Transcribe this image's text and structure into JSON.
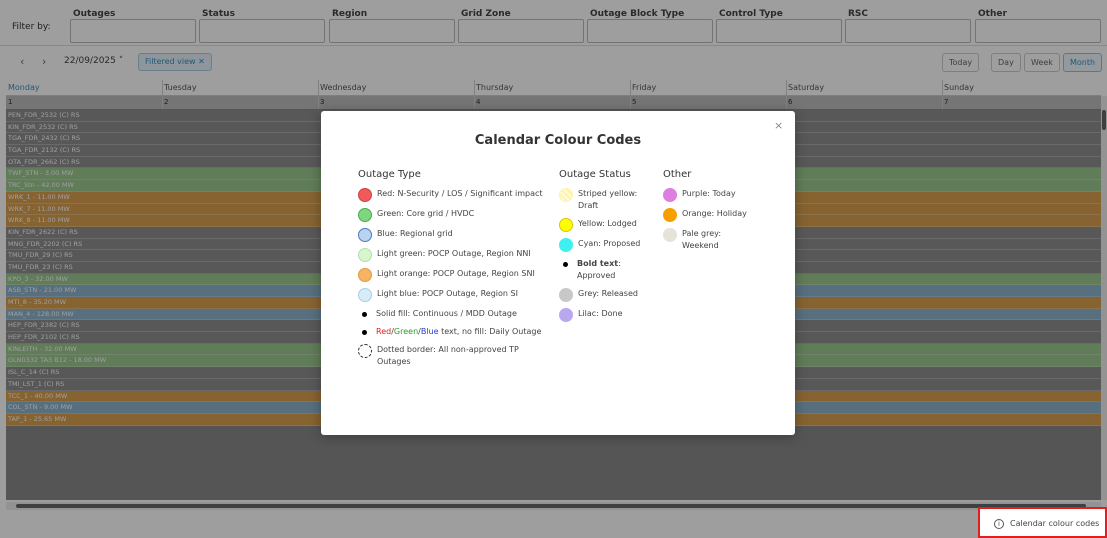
{
  "filters": {
    "label": "Filter by:",
    "columns": [
      {
        "title": "Outages"
      },
      {
        "title": "Status"
      },
      {
        "title": "Region"
      },
      {
        "title": "Grid Zone"
      },
      {
        "title": "Outage Block Type"
      },
      {
        "title": "Control Type"
      },
      {
        "title": "RSC"
      },
      {
        "title": "Other"
      }
    ]
  },
  "toolbar": {
    "prev": "‹",
    "next": "›",
    "date": "22/09/2025 ˅",
    "filtered_chip": "Filtered view ✕",
    "views": {
      "today": "Today",
      "day": "Day",
      "week": "Week",
      "month": "Month"
    },
    "active_view": "Month"
  },
  "calendar": {
    "days": [
      "Monday",
      "Tuesday",
      "Wednesday",
      "Thursday",
      "Friday",
      "Saturday",
      "Sunday"
    ],
    "day_numbers": [
      "1",
      "2",
      "3",
      "4",
      "5",
      "6",
      "7"
    ],
    "rows": [
      {
        "label": "PEN_FDR_2532 (C) RS",
        "color": "grey"
      },
      {
        "label": "KIN_FDR_2532 (C) RS",
        "color": "grey"
      },
      {
        "label": "TGA_FDR_2432 (C) RS",
        "color": "grey"
      },
      {
        "label": "TGA_FDR_2132 (C) RS",
        "color": "grey"
      },
      {
        "label": "OTA_FDR_2662 (C) RS",
        "color": "grey"
      },
      {
        "label": "TWF_STN - 3.00 MW",
        "color": "green"
      },
      {
        "label": "TRC_Stn - 42.00 MW",
        "color": "green"
      },
      {
        "label": "WRK_1 - 11.00 MW",
        "color": "orange"
      },
      {
        "label": "WRK_7 - 11.00 MW",
        "color": "orange"
      },
      {
        "label": "WRK_8 - 11.00 MW",
        "color": "orange"
      },
      {
        "label": "KIN_FDR_2622 (C) RS",
        "color": "grey"
      },
      {
        "label": "MNG_FDR_2202 (C) RS",
        "color": "grey"
      },
      {
        "label": "TMU_FDR_29 (C) RS",
        "color": "grey"
      },
      {
        "label": "TMU_FDR_23 (C) RS",
        "color": "grey"
      },
      {
        "label": "KPO_3 - 32.00 MW",
        "color": "green"
      },
      {
        "label": "ASB_STN - 21.00 MW",
        "color": "blue"
      },
      {
        "label": "MTI_8 - 35.20 MW",
        "color": "orange"
      },
      {
        "label": "MAN_4 - 128.00 MW",
        "color": "blue"
      },
      {
        "label": "HEP_FDR_2382 (C) RS",
        "color": "grey"
      },
      {
        "label": "HEP_FDR_2102 (C) RS",
        "color": "grey"
      },
      {
        "label": "KINLEITH - 32.00 MW",
        "color": "green"
      },
      {
        "label": "GLN0332 TA3 B12 - 18.00 MW",
        "color": "green"
      },
      {
        "label": "ISL_C_14 (C) RS",
        "color": "grey"
      },
      {
        "label": "TMI_LST_1 (C) RS",
        "color": "grey"
      },
      {
        "label": "TCC_1 - 40.00 MW",
        "color": "orange"
      },
      {
        "label": "COL_STN - 9.00 MW",
        "color": "blue"
      },
      {
        "label": "TAP_1 - 25.65 MW",
        "color": "orange"
      }
    ]
  },
  "modal": {
    "title": "Calendar Colour Codes",
    "close": "×",
    "outage_type": {
      "title": "Outage Type",
      "items": [
        {
          "text": "Red: N-Security / LOS / Significant impact",
          "fill": "#f05a5a",
          "border": "#d04040"
        },
        {
          "text": "Green: Core grid / HVDC",
          "fill": "#7ed67e",
          "border": "#4caa4c"
        },
        {
          "text": "Blue: Regional grid",
          "fill": "#b9d4f0",
          "border": "#4a78c0"
        },
        {
          "text": "Light green: POCP Outage, Region NNI",
          "fill": "#d8f5d0",
          "border": "#b0e0a8"
        },
        {
          "text": "Light orange: POCP Outage, Region SNI",
          "fill": "#f5b562",
          "border": "#e09a40"
        },
        {
          "text": "Light blue: POCP Outage, Region SI",
          "fill": "#d6ecf8",
          "border": "#a8cde6"
        }
      ],
      "solid_fill": "Solid fill: Continuous / MDD Outage",
      "text_red": "Red",
      "text_green": "Green",
      "text_blue": "Blue",
      "text_rest": "text, no fill: Daily Outage",
      "slash": "/",
      "dotted": "Dotted border: All non-approved TP Outages"
    },
    "outage_status": {
      "title": "Outage Status",
      "items": [
        {
          "text": "Striped yellow: Draft",
          "fill": "#fff3a8",
          "border": "#fff3a8"
        },
        {
          "text": "Yellow: Lodged",
          "fill": "#ffff00",
          "border": "#d8c800"
        },
        {
          "text": "Cyan: Proposed",
          "fill": "#40f0f0",
          "border": "#40f0f0"
        }
      ],
      "bold_label": "Bold text",
      "bold_rest": ": Approved",
      "items2": [
        {
          "text": "Grey: Released",
          "fill": "#c8c8c8",
          "border": "#c8c8c8"
        },
        {
          "text": "Lilac: Done",
          "fill": "#b9a8f0",
          "border": "#b9a8f0"
        }
      ]
    },
    "other": {
      "title": "Other",
      "items": [
        {
          "text": "Purple: Today",
          "fill": "#dd7fe0",
          "border": "#dd7fe0"
        },
        {
          "text": "Orange: Holiday",
          "fill": "#f5a000",
          "border": "#f5a000"
        },
        {
          "text": "Pale grey: Weekend",
          "fill": "#e6e3d8",
          "border": "#e6e3d8"
        }
      ]
    }
  },
  "footer": {
    "colour_codes_label": "Calendar colour codes",
    "info_icon": "i"
  }
}
